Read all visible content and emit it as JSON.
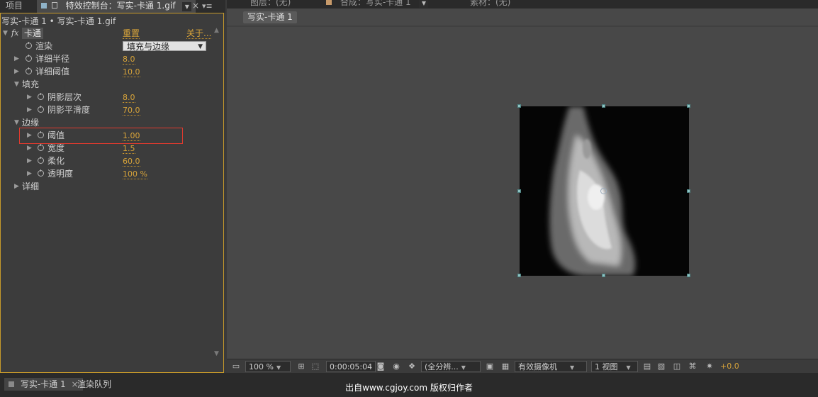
{
  "left_tabs": {
    "project": "项目",
    "effect_controls": "特效控制台：写实-卡通 1.gif",
    "close": "×",
    "menu": "▾≡"
  },
  "right_tabs": {
    "layer": "图层：(无)",
    "composition": "合成：写实-卡通 1",
    "footage": "素材：(无)"
  },
  "effect_controls": {
    "breadcrumb": "写实-卡通 1 • 写实-卡通 1.gif",
    "fx": "fx",
    "effect_name": "卡通",
    "reset": "重置",
    "about": "关于...",
    "render_label": "渲染",
    "render_value": "填充与边缘",
    "params": [
      {
        "label": "详细半径",
        "value": "8.0"
      },
      {
        "label": "详细阈值",
        "value": "10.0"
      }
    ],
    "fill_group": "填充",
    "fill_params": [
      {
        "label": "阴影层次",
        "value": "8.0"
      },
      {
        "label": "阴影平滑度",
        "value": "70.0"
      }
    ],
    "edge_group": "边缘",
    "edge_params": [
      {
        "label": "阈值",
        "value": "1.00"
      },
      {
        "label": "宽度",
        "value": "1.5"
      },
      {
        "label": "柔化",
        "value": "60.0"
      },
      {
        "label": "透明度",
        "value": "100 %"
      }
    ],
    "detail_group": "详细"
  },
  "viewer": {
    "comp_tab": "写实-卡通 1"
  },
  "toolbar": {
    "zoom": "100 %",
    "timecode": "0:00:05:04",
    "resolution": "(全分辨...",
    "camera": "有效摄像机",
    "views": "1 视图",
    "exposure": "+0.0"
  },
  "bottom_tabs": {
    "timeline": "写实-卡通 1",
    "close": "×",
    "render_queue": "渲染队列"
  },
  "watermark": "出自www.cgjoy.com 版权归作者",
  "colors": {
    "accent_value": "#d8a43a",
    "panel_border": "#c79a2a",
    "highlight_box": "#e03a2e"
  }
}
